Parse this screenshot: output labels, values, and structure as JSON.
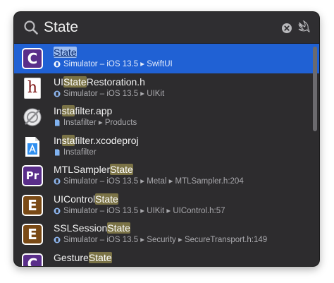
{
  "search": {
    "query": "State"
  },
  "results": [
    {
      "icon": "swift-class-c-icon",
      "letter": "C",
      "kind": "c",
      "title": [
        {
          "t": "State",
          "h": true
        }
      ],
      "sub_icon": "simulator-icon",
      "subtitle": "Simulator – iOS 13.5 ▸ SwiftUI",
      "selected": true
    },
    {
      "icon": "header-file-icon",
      "letter": "h",
      "kind": "h",
      "title": [
        {
          "t": "UI",
          "h": false
        },
        {
          "t": "State",
          "h": true
        },
        {
          "t": "Restoration.h",
          "h": false
        }
      ],
      "sub_icon": "simulator-icon",
      "subtitle": "Simulator – iOS 13.5 ▸ UIKit",
      "selected": false
    },
    {
      "icon": "app-icon",
      "letter": "",
      "kind": "app",
      "title": [
        {
          "t": "In",
          "h": false
        },
        {
          "t": "sta",
          "h": true
        },
        {
          "t": "filter.app",
          "h": false
        }
      ],
      "sub_icon": "file-icon",
      "subtitle": "Instafilter ▸ Products",
      "selected": false
    },
    {
      "icon": "xcodeproj-icon",
      "letter": "",
      "kind": "xcodeproj",
      "title": [
        {
          "t": "In",
          "h": false
        },
        {
          "t": "sta",
          "h": true
        },
        {
          "t": "filter.xcodeproj",
          "h": false
        }
      ],
      "sub_icon": "file-icon",
      "subtitle": "Instafilter",
      "selected": false
    },
    {
      "icon": "protocol-pr-icon",
      "letter": "Pr",
      "kind": "pr",
      "title": [
        {
          "t": "MTLSampler",
          "h": false
        },
        {
          "t": "State",
          "h": true
        }
      ],
      "sub_icon": "simulator-icon",
      "subtitle": "Simulator – iOS 13.5 ▸ Metal ▸ MTLSampler.h:204",
      "selected": false
    },
    {
      "icon": "enum-e-icon",
      "letter": "E",
      "kind": "e",
      "title": [
        {
          "t": "UIControl",
          "h": false
        },
        {
          "t": "State",
          "h": true
        }
      ],
      "sub_icon": "simulator-icon",
      "subtitle": "Simulator – iOS 13.5 ▸ UIKit ▸ UIControl.h:57",
      "selected": false
    },
    {
      "icon": "enum-e-icon",
      "letter": "E",
      "kind": "e",
      "title": [
        {
          "t": "SSLSession",
          "h": false
        },
        {
          "t": "State",
          "h": true
        }
      ],
      "sub_icon": "simulator-icon",
      "subtitle": "Simulator – iOS 13.5 ▸ Security ▸ SecureTransport.h:149",
      "selected": false
    },
    {
      "icon": "swift-class-c-icon",
      "letter": "C",
      "kind": "c",
      "title": [
        {
          "t": "Gesture",
          "h": false
        },
        {
          "t": "State",
          "h": true
        }
      ],
      "sub_icon": "simulator-icon",
      "subtitle": "",
      "selected": false
    }
  ],
  "colors": {
    "panel": "#2d2c2e",
    "selection": "#2061d4",
    "match_highlight": "#7b7346"
  }
}
